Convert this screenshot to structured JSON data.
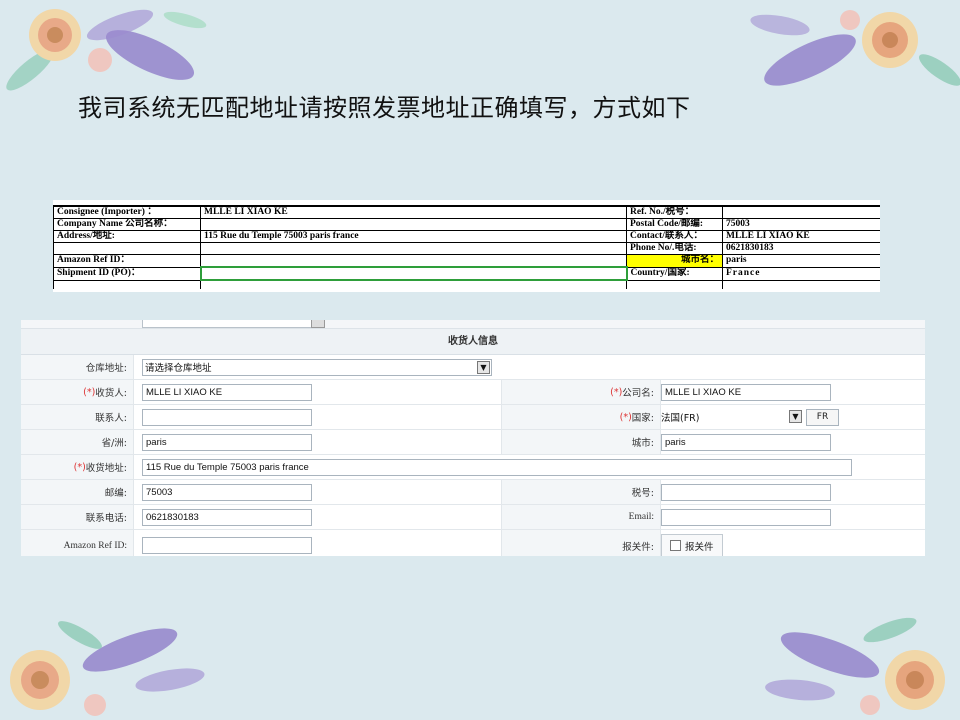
{
  "slide_title": "我司系统无匹配地址请按照发票地址正确填写，方式如下",
  "invoice": {
    "rows": [
      {
        "l1": "Consignee (Importer) ：",
        "v1": "MLLE LI XIAO KE",
        "l2": "Ref. No./税号：",
        "v2": ""
      },
      {
        "l1": "Company Name 公司名称：",
        "v1": "",
        "l2": "Postal Code/邮编:",
        "v2": "75003"
      },
      {
        "l1": "Address/地址:",
        "v1": "115 Rue du Temple  75003 paris france",
        "l2": "Contact/联系人：",
        "v2": "MLLE LI XIAO KE"
      },
      {
        "l1": "",
        "v1": "",
        "l2": "Phone No/.电话:",
        "v2": "0621830183"
      },
      {
        "l1": "Amazon Ref ID：",
        "v1": "",
        "l2": "城市名：",
        "v2": "paris"
      },
      {
        "l1": "Shipment ID (PO)：",
        "v1": "",
        "l2": "Country/国家:",
        "v2": "France"
      }
    ]
  },
  "form": {
    "section_title": "收货人信息",
    "warehouse": {
      "label": "仓库地址:",
      "value": "请选择仓库地址"
    },
    "consignee": {
      "req": "(*)",
      "label": "收货人:",
      "value": "MLLE LI XIAO KE"
    },
    "company": {
      "req": "(*)",
      "label": "公司名:",
      "value": "MLLE LI XIAO KE"
    },
    "contact": {
      "label": "联系人:",
      "value": ""
    },
    "country": {
      "req": "(*)",
      "label": "国家:",
      "value": "法国(FR)",
      "code": "FR"
    },
    "province": {
      "label": "省/洲:",
      "value": "paris"
    },
    "city": {
      "label": "城市:",
      "value": "paris"
    },
    "address": {
      "req": "(*)",
      "label": "收货地址:",
      "value": "115 Rue du Temple  75003 paris france"
    },
    "postcode": {
      "label": "邮编:",
      "value": "75003"
    },
    "tax": {
      "label": "税号:",
      "value": ""
    },
    "phone": {
      "label": "联系电话:",
      "value": "0621830183"
    },
    "email": {
      "label": "Email:",
      "value": ""
    },
    "amazon_ref": {
      "label": "Amazon Ref ID:",
      "value": ""
    },
    "customs": {
      "label": "报关件:",
      "checkbox_label": "报关件"
    }
  }
}
